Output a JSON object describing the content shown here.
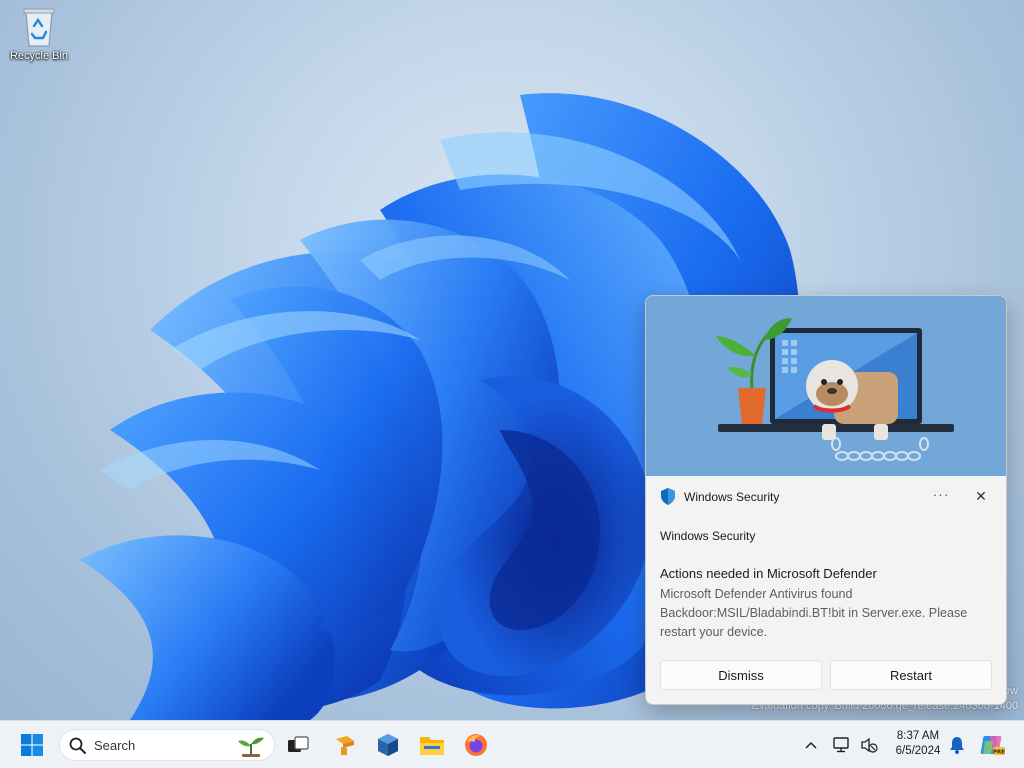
{
  "desktop": {
    "recycle_bin_label": "Recycle Bin",
    "watermark_line1": "ew",
    "watermark_line2": "Evaluation copy. Build 26080.ge_release.240308-1400"
  },
  "toast": {
    "app_name": "Windows Security",
    "more_label": "···",
    "close_label": "✕",
    "source": "Windows Security",
    "title": "Actions needed in Microsoft Defender",
    "body": "Microsoft Defender Antivirus found Backdoor:MSIL/Bladabindi.BT!bit in Server.exe. Please restart your device.",
    "dismiss_label": "Dismiss",
    "restart_label": "Restart"
  },
  "taskbar": {
    "search_placeholder": "Search",
    "apps": [
      "start-icon",
      "task-view-icon",
      "setup-app-icon",
      "virtualbox-icon",
      "file-explorer-icon",
      "firefox-icon"
    ],
    "clock_time": "8:37 AM",
    "clock_date": "6/5/2024",
    "chevron_label": "^"
  },
  "colors": {
    "accent": "#0067c0",
    "hero_bg": "#72a7d8",
    "toast_bg": "#f3f3f3",
    "taskbar_bg": "#eef1f5"
  }
}
